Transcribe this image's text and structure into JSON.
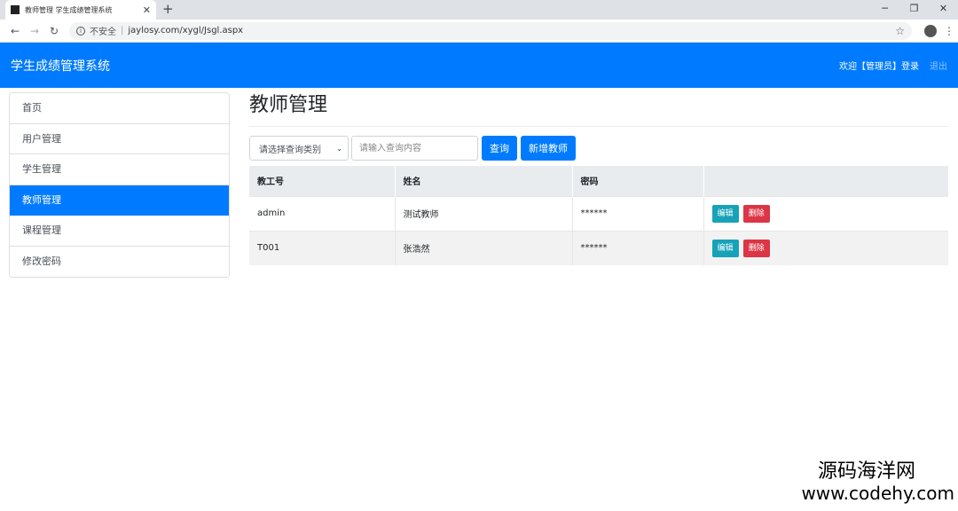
{
  "browser": {
    "tab_title": "教师管理 学生成绩管理系统",
    "tab_close": "✕",
    "new_tab": "+",
    "insecure": "不安全",
    "url": "jaylosy.com/xygl/Jsgl.aspx",
    "icons": {
      "back": "arrow-left-icon",
      "forward": "arrow-right-icon",
      "reload": "reload-icon",
      "star": "star-icon",
      "account": "account-icon",
      "menu": "more-vert-icon"
    }
  },
  "window_controls": {
    "minimize": "─",
    "restore": "❐",
    "close": "✕"
  },
  "navbar": {
    "brand": "学生成绩管理系统",
    "welcome": "欢迎【管理员】登录",
    "logout": "退出",
    "bg_color": "#007bff"
  },
  "sidebar": {
    "items": [
      {
        "label": "首页",
        "active": false
      },
      {
        "label": "用户管理",
        "active": false
      },
      {
        "label": "学生管理",
        "active": false
      },
      {
        "label": "教师管理",
        "active": true
      },
      {
        "label": "课程管理",
        "active": false
      },
      {
        "label": "修改密码",
        "active": false
      }
    ]
  },
  "main": {
    "title": "教师管理",
    "search": {
      "select_value": "请选择查询类别",
      "input_placeholder": "请输入查询内容",
      "query_label": "查询",
      "add_label": "新增教师"
    },
    "table": {
      "columns": [
        "教工号",
        "姓名",
        "密码",
        ""
      ],
      "rows": [
        {
          "id": "admin",
          "name": "测试教师",
          "password": "******",
          "edit": "编辑",
          "delete": "删除"
        },
        {
          "id": "T001",
          "name": "张浩然",
          "password": "******",
          "edit": "编辑",
          "delete": "删除"
        }
      ]
    }
  },
  "watermark": {
    "name": "源码海洋网",
    "url": "www.codehy.com"
  },
  "colors": {
    "primary": "#007bff",
    "info": "#17a2b8",
    "danger": "#dc3545"
  }
}
